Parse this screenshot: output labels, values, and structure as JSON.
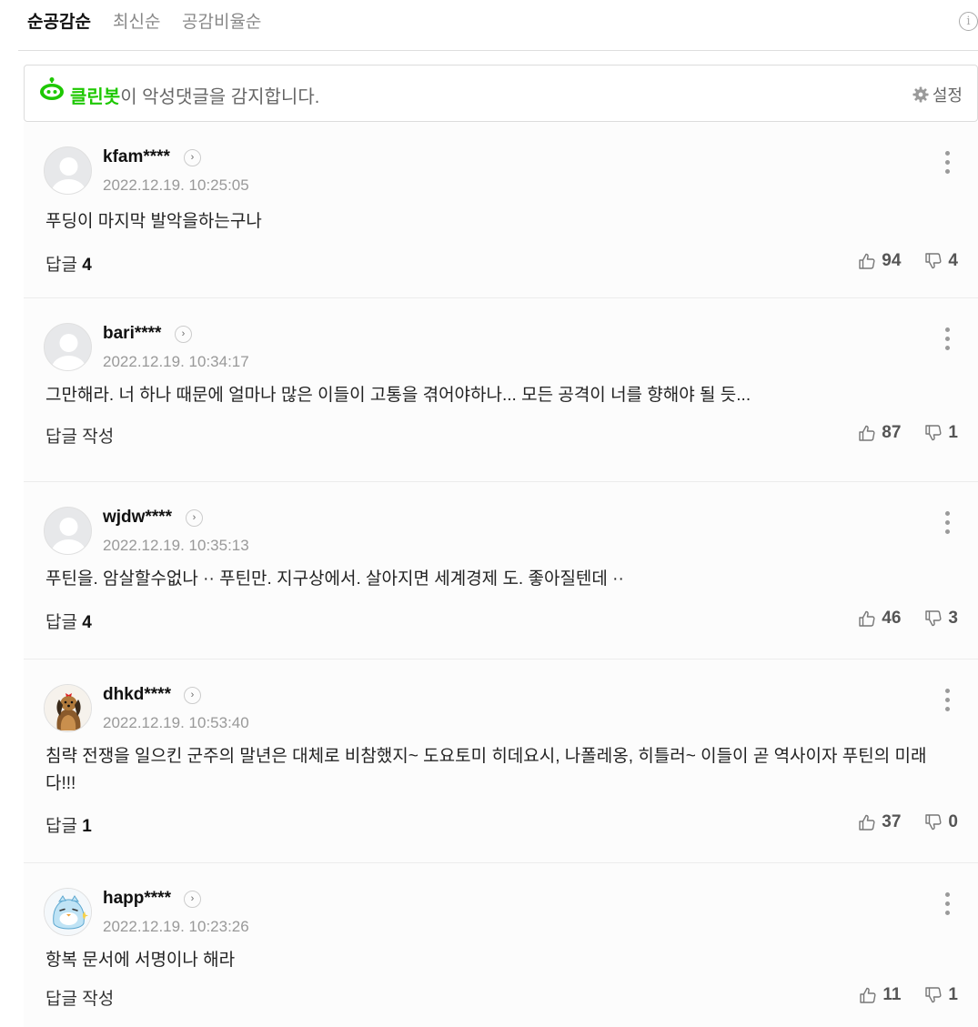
{
  "sort": {
    "tabs": [
      "순공감순",
      "최신순",
      "공감비율순"
    ],
    "active_index": 0,
    "info_symbol": "i"
  },
  "cleanbot": {
    "brand": "클린봇",
    "text": "이 악성댓글을 감지합니다.",
    "settings_label": "설정",
    "brand_color": "#1ec800"
  },
  "comments": [
    {
      "username": "kfam****",
      "timestamp": "2022.12.19. 10:25:05",
      "body": "푸딩이 마지막 발악을하는구나",
      "reply_label": "답글",
      "reply_count": "4",
      "likes": "94",
      "dislikes": "4",
      "avatar": "default"
    },
    {
      "username": "bari****",
      "timestamp": "2022.12.19. 10:34:17",
      "body": "그만해라. 너 하나 때문에 얼마나 많은 이들이 고통을 겪어야하나... 모든 공격이 너를 향해야 될 듯...",
      "reply_label": "답글 작성",
      "reply_count": "",
      "likes": "87",
      "dislikes": "1",
      "avatar": "default"
    },
    {
      "username": "wjdw****",
      "timestamp": "2022.12.19. 10:35:13",
      "body": "푸틴을. 암살할수없나 ·· 푸틴만. 지구상에서. 살아지면 세계경제 도. 좋아질텐데 ··",
      "reply_label": "답글",
      "reply_count": "4",
      "likes": "46",
      "dislikes": "3",
      "avatar": "default"
    },
    {
      "username": "dhkd****",
      "timestamp": "2022.12.19. 10:53:40",
      "body": "침략 전쟁을 일으킨 군주의 말년은 대체로 비참했지~ 도요토미 히데요시, 나폴레옹, 히틀러~ 이들이 곧 역사이자 푸틴의 미래다!!!",
      "reply_label": "답글",
      "reply_count": "1",
      "likes": "37",
      "dislikes": "0",
      "avatar": "dog"
    },
    {
      "username": "happ****",
      "timestamp": "2022.12.19. 10:23:26",
      "body": "항복 문서에 서명이나 해라",
      "reply_label": "답글 작성",
      "reply_count": "",
      "likes": "11",
      "dislikes": "1",
      "avatar": "bird"
    }
  ]
}
